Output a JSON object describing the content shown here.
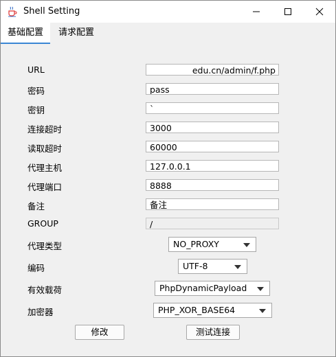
{
  "window": {
    "title": "Shell Setting",
    "icon": "java-cup-icon",
    "controls": [
      "minimize",
      "maximize",
      "close"
    ]
  },
  "tabs": [
    {
      "label": "基础配置",
      "active": true
    },
    {
      "label": "请求配置",
      "active": false
    }
  ],
  "form": {
    "url": {
      "label": "URL",
      "value": "edu.cn/admin/f.php"
    },
    "password": {
      "label": "密码",
      "value": "pass"
    },
    "secret_key": {
      "label": "密钥",
      "value": "`"
    },
    "connect_timeout": {
      "label": "连接超时",
      "value": "3000"
    },
    "read_timeout": {
      "label": "读取超时",
      "value": "60000"
    },
    "proxy_host": {
      "label": "代理主机",
      "value": "127.0.0.1"
    },
    "proxy_port": {
      "label": "代理端口",
      "value": "8888"
    },
    "remark": {
      "label": "备注",
      "value": "备注"
    },
    "group": {
      "label": "GROUP",
      "value": "/"
    },
    "proxy_type": {
      "label": "代理类型",
      "value": "NO_PROXY"
    },
    "encoding": {
      "label": "编码",
      "value": "UTF-8"
    },
    "payload": {
      "label": "有效载荷",
      "value": "PhpDynamicPayload"
    },
    "cryption": {
      "label": "加密器",
      "value": "PHP_XOR_BASE64"
    }
  },
  "buttons": {
    "modify": "修改",
    "test_connection": "测试连接"
  },
  "colors": {
    "tab_accent": "#3a86d4",
    "panel_bg": "#f0f0f0"
  }
}
